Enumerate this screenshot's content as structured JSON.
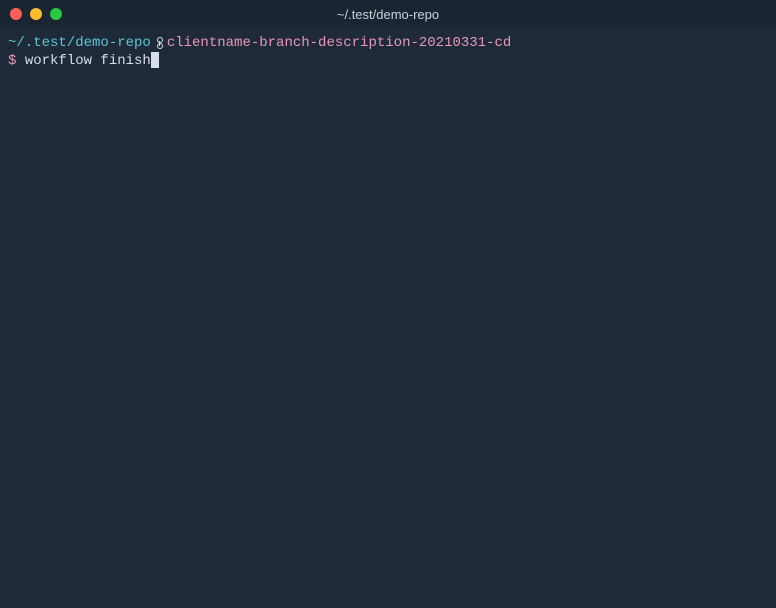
{
  "window": {
    "title": "~/.test/demo-repo"
  },
  "prompt": {
    "cwd": "~/.test/demo-repo",
    "branch": "clientname-branch-description-20210331-cd",
    "symbol": "$"
  },
  "command": {
    "input": "workflow finish"
  },
  "colors": {
    "background": "#1e2a38",
    "cwd": "#58c7d6",
    "branch": "#e898b8",
    "text": "#d8dee9"
  }
}
